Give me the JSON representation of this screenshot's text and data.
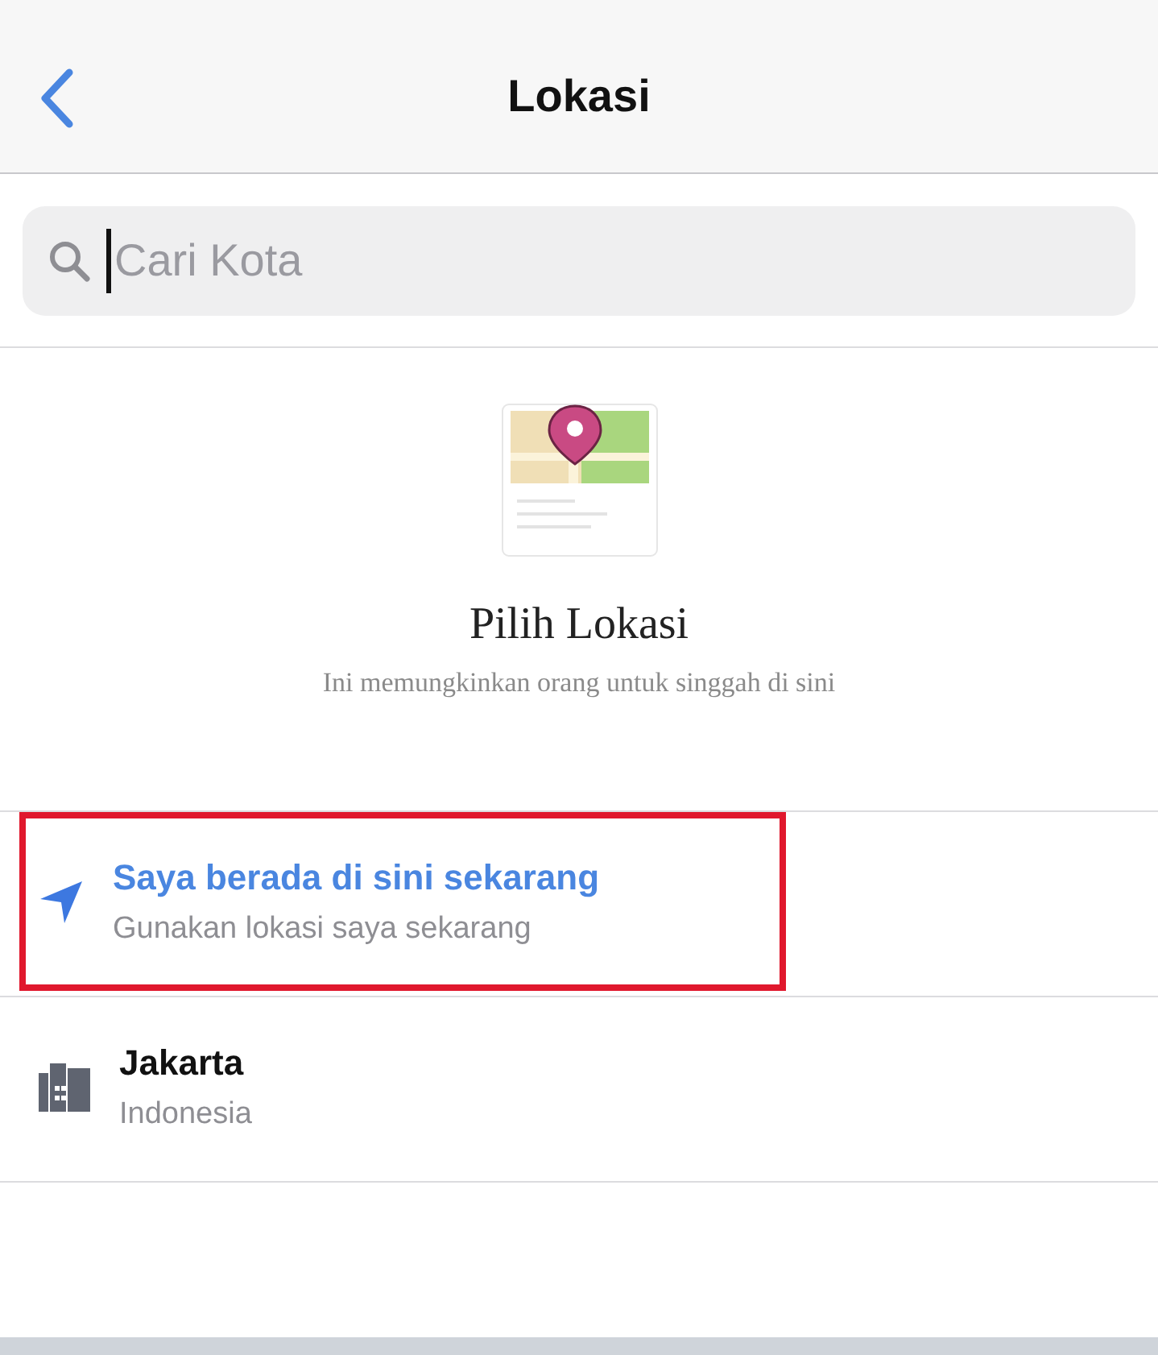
{
  "nav_bar": {
    "title": "Lokasi"
  },
  "search": {
    "placeholder": "Cari Kota"
  },
  "empty_state": {
    "title": "Pilih Lokasi",
    "subtitle": "Ini memungkinkan orang untuk singgah di sini"
  },
  "locations": [
    {
      "kind": "current",
      "title": "Saya berada di sini sekarang",
      "subtitle": "Gunakan lokasi saya sekarang",
      "highlighted": true
    },
    {
      "kind": "city",
      "title": "Jakarta",
      "subtitle": "Indonesia",
      "highlighted": false
    }
  ]
}
